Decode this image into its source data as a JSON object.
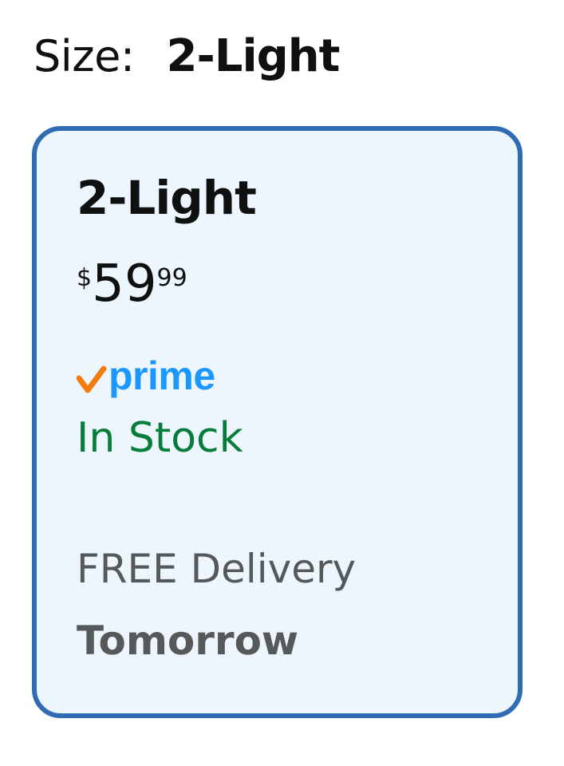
{
  "size_selector": {
    "label": "Size:",
    "selected_value": "2-Light"
  },
  "option": {
    "name": "2-Light",
    "price": {
      "symbol": "$",
      "whole": "59",
      "fraction": "99"
    },
    "prime_label": "prime",
    "availability": "In Stock",
    "delivery_text": "FREE Delivery",
    "delivery_date": "Tomorrow",
    "selected": true
  },
  "colors": {
    "card_border": "#2f6cb4",
    "card_background": "#eef6fd",
    "prime_blue": "#1a98ff",
    "prime_check_orange": "#f47c0e",
    "in_stock_green": "#067d3a",
    "delivery_gray": "#565959"
  },
  "icons": {
    "prime_check": "checkmark-icon"
  }
}
